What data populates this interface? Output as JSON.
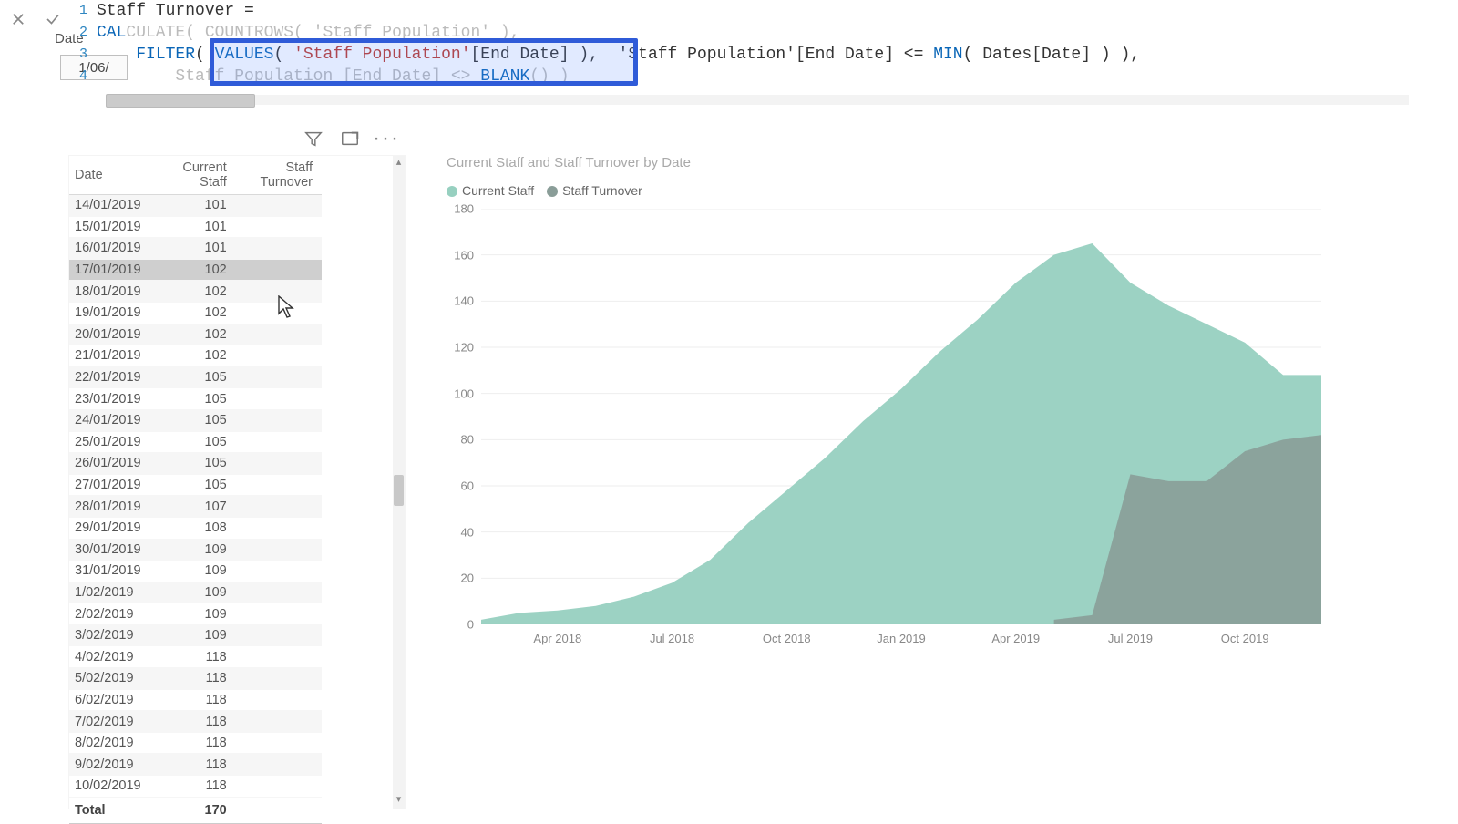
{
  "formula": {
    "measure_name": "Staff Turnover",
    "line1_a": "Staff Turnover ",
    "line1_b": "=",
    "line2_pre_kw": "CAL",
    "line2_kw_hidden": "CULATE",
    "line2_mid_dim": "( ",
    "line2_fn_hidden": "COUNTROWS",
    "line2_tail_dim": "( 'Staff Population' ),",
    "line3_filter": "FILTER",
    "line3_values": "VALUES",
    "line3_str": "'Staff Population'",
    "line3_col": "[End Date]",
    "line3_after_box": "'Staff Population'[End Date] <= ",
    "line3_min": "MIN",
    "line3_min_arg": "( Dates[Date] ) ),",
    "line4_pre": "        Staff Population [End Date] <> ",
    "line4_blank": "BLANK",
    "line4_tail": "() )"
  },
  "slicer": {
    "label": "Date",
    "value": "1/06/"
  },
  "toolbar": {
    "filter_tip": "Filter",
    "focus_tip": "Focus mode",
    "more_tip": "More options"
  },
  "table": {
    "headers": {
      "date": "Date",
      "current": "Current Staff",
      "turnover": "Staff Turnover"
    },
    "rows": [
      {
        "date": "14/01/2019",
        "current": 101,
        "turnover": ""
      },
      {
        "date": "15/01/2019",
        "current": 101,
        "turnover": ""
      },
      {
        "date": "16/01/2019",
        "current": 101,
        "turnover": ""
      },
      {
        "date": "17/01/2019",
        "current": 102,
        "turnover": ""
      },
      {
        "date": "18/01/2019",
        "current": 102,
        "turnover": ""
      },
      {
        "date": "19/01/2019",
        "current": 102,
        "turnover": ""
      },
      {
        "date": "20/01/2019",
        "current": 102,
        "turnover": ""
      },
      {
        "date": "21/01/2019",
        "current": 102,
        "turnover": ""
      },
      {
        "date": "22/01/2019",
        "current": 105,
        "turnover": ""
      },
      {
        "date": "23/01/2019",
        "current": 105,
        "turnover": ""
      },
      {
        "date": "24/01/2019",
        "current": 105,
        "turnover": ""
      },
      {
        "date": "25/01/2019",
        "current": 105,
        "turnover": ""
      },
      {
        "date": "26/01/2019",
        "current": 105,
        "turnover": ""
      },
      {
        "date": "27/01/2019",
        "current": 105,
        "turnover": ""
      },
      {
        "date": "28/01/2019",
        "current": 107,
        "turnover": ""
      },
      {
        "date": "29/01/2019",
        "current": 108,
        "turnover": ""
      },
      {
        "date": "30/01/2019",
        "current": 109,
        "turnover": ""
      },
      {
        "date": "31/01/2019",
        "current": 109,
        "turnover": ""
      },
      {
        "date": "1/02/2019",
        "current": 109,
        "turnover": ""
      },
      {
        "date": "2/02/2019",
        "current": 109,
        "turnover": ""
      },
      {
        "date": "3/02/2019",
        "current": 109,
        "turnover": ""
      },
      {
        "date": "4/02/2019",
        "current": 118,
        "turnover": ""
      },
      {
        "date": "5/02/2019",
        "current": 118,
        "turnover": ""
      },
      {
        "date": "6/02/2019",
        "current": 118,
        "turnover": ""
      },
      {
        "date": "7/02/2019",
        "current": 118,
        "turnover": ""
      },
      {
        "date": "8/02/2019",
        "current": 118,
        "turnover": ""
      },
      {
        "date": "9/02/2019",
        "current": 118,
        "turnover": ""
      },
      {
        "date": "10/02/2019",
        "current": 118,
        "turnover": ""
      }
    ],
    "hover_index": 3,
    "total_label": "Total",
    "total_current": 170
  },
  "chart": {
    "title": "Current Staff and Staff Turnover by Date",
    "legend": {
      "current": "Current Staff",
      "turnover": "Staff Turnover"
    },
    "colors": {
      "current": "#97d0c0",
      "turnover": "#8a9d98"
    },
    "y_ticks": [
      0,
      20,
      40,
      60,
      80,
      100,
      120,
      140,
      160,
      180
    ],
    "x_ticks": [
      "Apr 2018",
      "Jul 2018",
      "Oct 2018",
      "Jan 2019",
      "Apr 2019",
      "Jul 2019",
      "Oct 2019"
    ]
  },
  "chart_data": {
    "type": "area",
    "xlabel": "",
    "ylabel": "",
    "ylim": [
      0,
      180
    ],
    "x": [
      "Feb 2018",
      "Mar 2018",
      "Apr 2018",
      "May 2018",
      "Jun 2018",
      "Jul 2018",
      "Aug 2018",
      "Sep 2018",
      "Oct 2018",
      "Nov 2018",
      "Dec 2018",
      "Jan 2019",
      "Feb 2019",
      "Mar 2019",
      "Apr 2019",
      "May 2019",
      "Jun 2019",
      "Jul 2019",
      "Aug 2019",
      "Sep 2019",
      "Oct 2019",
      "Nov 2019",
      "Dec 2019"
    ],
    "series": [
      {
        "name": "Current Staff",
        "values": [
          2,
          5,
          6,
          8,
          12,
          18,
          28,
          44,
          58,
          72,
          88,
          102,
          118,
          132,
          148,
          160,
          165,
          148,
          138,
          130,
          122,
          108,
          108
        ]
      },
      {
        "name": "Staff Turnover",
        "values": [
          0,
          0,
          0,
          0,
          0,
          0,
          0,
          0,
          0,
          0,
          0,
          0,
          0,
          0,
          0,
          2,
          4,
          65,
          62,
          62,
          75,
          80,
          82
        ]
      }
    ]
  }
}
